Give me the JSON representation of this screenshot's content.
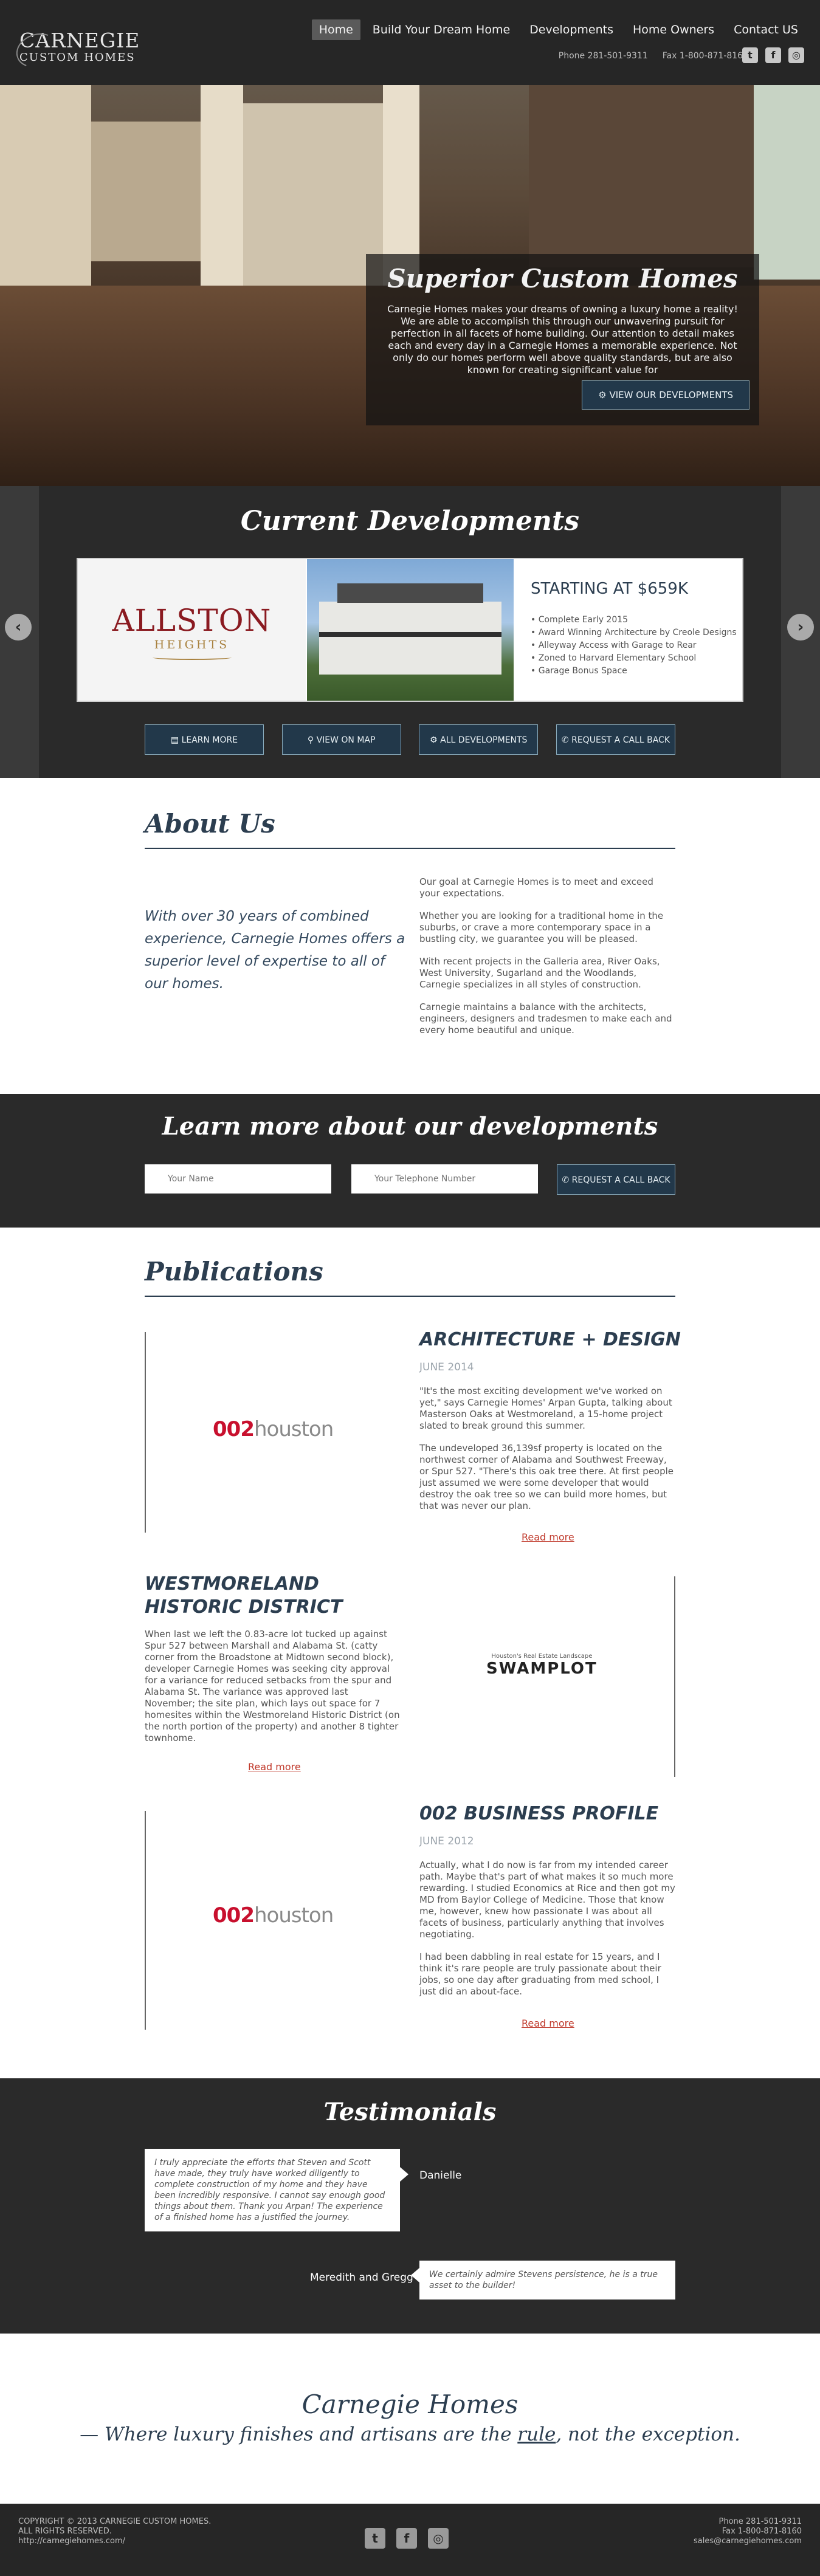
{
  "header": {
    "logo_line1": "CARNEGIE",
    "logo_line2": "CUSTOM HOMES",
    "nav": [
      "Home",
      "Build Your Dream Home",
      "Developments",
      "Home Owners",
      "Contact US"
    ],
    "active_nav": "Home",
    "phone": "Phone 281-501-9311",
    "fax": "Fax 1-800-871-8160",
    "social_icons": [
      "twitter-icon",
      "facebook-icon",
      "instagram-icon"
    ]
  },
  "hero": {
    "title": "Superior Custom Homes",
    "text": "Carnegie Homes makes your dreams of owning a luxury home a reality! We are able to accomplish this through our unwavering pursuit for perfection in all facets of home building. Our attention to detail makes each and every day in a Carnegie Homes a memorable experience. Not only do our homes perform well above quality standards, but are also known for creating significant value for",
    "button": "VIEW OUR DEVELOPMENTS"
  },
  "developments": {
    "title": "Current Developments",
    "name_line1": "ALLSTON",
    "name_line2": "HEIGHTS",
    "price": "STARTING AT $659K",
    "features": [
      "Complete Early 2015",
      "Award Winning Architecture by Creole Designs",
      "Alleyway Access with Garage to Rear",
      "Zoned to Harvard Elementary School",
      "Garage Bonus Space"
    ],
    "buttons": [
      "LEARN MORE",
      "VIEW ON MAP",
      "ALL DEVELOPMENTS",
      "REQUEST A CALL BACK"
    ]
  },
  "about": {
    "title": "About Us",
    "quote": "With over 30 years of combined experience, Carnegie Homes offers a superior level of expertise to all of our homes.",
    "paragraphs": [
      "Our goal at Carnegie Homes is to meet and exceed your expectations.",
      "Whether you are looking for a traditional home in the suburbs, or crave a more contemporary space in a bustling city, we guarantee you will be pleased.",
      "With recent projects in the Galleria area, River Oaks, West University, Sugarland and the Woodlands, Carnegie specializes in all styles of construction.",
      "Carnegie maintains a balance with the architects, engineers, designers and tradesmen to make each and every home beautiful and unique."
    ]
  },
  "learn": {
    "title": "Learn more about our developments",
    "name_placeholder": "Your Name",
    "phone_placeholder": "Your Telephone Number",
    "button": "REQUEST A CALL BACK"
  },
  "publications": {
    "title": "Publications",
    "logo_002_a": "002",
    "logo_002_b": "houston",
    "swamplot_small": "Houston's Real Estate Landscape",
    "swamplot_big": "SWAMPLOT",
    "read_more": "Read more",
    "items": [
      {
        "heading": "ARCHITECTURE + DESIGN",
        "date": "JUNE 2014",
        "paragraphs": [
          "\"It's the most exciting development we've worked on yet,\" says Carnegie Homes' Arpan Gupta, talking about Masterson Oaks at Westmoreland, a 15-home project slated to break ground this summer.",
          "The undeveloped 36,139sf property is located on the northwest corner of Alabama and Southwest Freeway, or Spur 527. \"There's this oak tree there. At first people just assumed we were some developer that would destroy the oak tree so we can build more homes, but that was never our plan."
        ]
      },
      {
        "heading_line1": "WESTMORELAND",
        "heading_line2": "HISTORIC DISTRICT",
        "paragraphs": [
          "When last we left the 0.83-acre lot tucked up against Spur 527 between Marshall and Alabama St. (catty corner from the Broadstone at Midtown second block), developer Carnegie Homes was seeking city approval for a variance for reduced setbacks from the spur and Alabama St. The variance was approved last November; the site plan, which lays out space for 7 homesites within the Westmoreland Historic District (on the north portion of the property) and another 8 tighter townhome."
        ]
      },
      {
        "heading": "002 BUSINESS PROFILE",
        "date": "JUNE 2012",
        "paragraphs": [
          "Actually, what I do now is far from my intended career path. Maybe that's part of what makes it so much more rewarding. I studied Economics at Rice and then got my MD from Baylor College of Medicine. Those that know me, however, knew how passionate I was about all facets of business, particularly anything that involves negotiating.",
          "I had been dabbling in real estate for 15 years, and I think it's rare people are truly passionate about their jobs, so one day after graduating from med school, I just did an about-face."
        ]
      }
    ]
  },
  "testimonials": {
    "title": "Testimonials",
    "items": [
      {
        "text": "I truly appreciate the efforts that Steven and Scott have made, they truly have worked diligently to complete construction of my home and they have been incredibly responsive. I cannot say enough good things about them. Thank you Arpan! The experience of a finished home has a justified the journey.",
        "name": "Danielle"
      },
      {
        "text": "We certainly admire Stevens persistence, he is a true asset to the builder!",
        "name": "Meredith and Gregg"
      }
    ]
  },
  "tagline": {
    "brand": "Carnegie Homes",
    "line_before": "— Where luxury finishes and artisans are the ",
    "line_rule": "rule",
    "line_after": ", not the exception."
  },
  "footer": {
    "copyright": "COPYRIGHT © 2013 CARNEGIE CUSTOM HOMES.",
    "rights": "ALL RIGHTS RESERVED.",
    "url": "http://carnegiehomes.com/",
    "phone": "Phone 281-501-9311",
    "fax": "Fax 1-800-871-8160",
    "email": "sales@carnegiehomes.com"
  }
}
